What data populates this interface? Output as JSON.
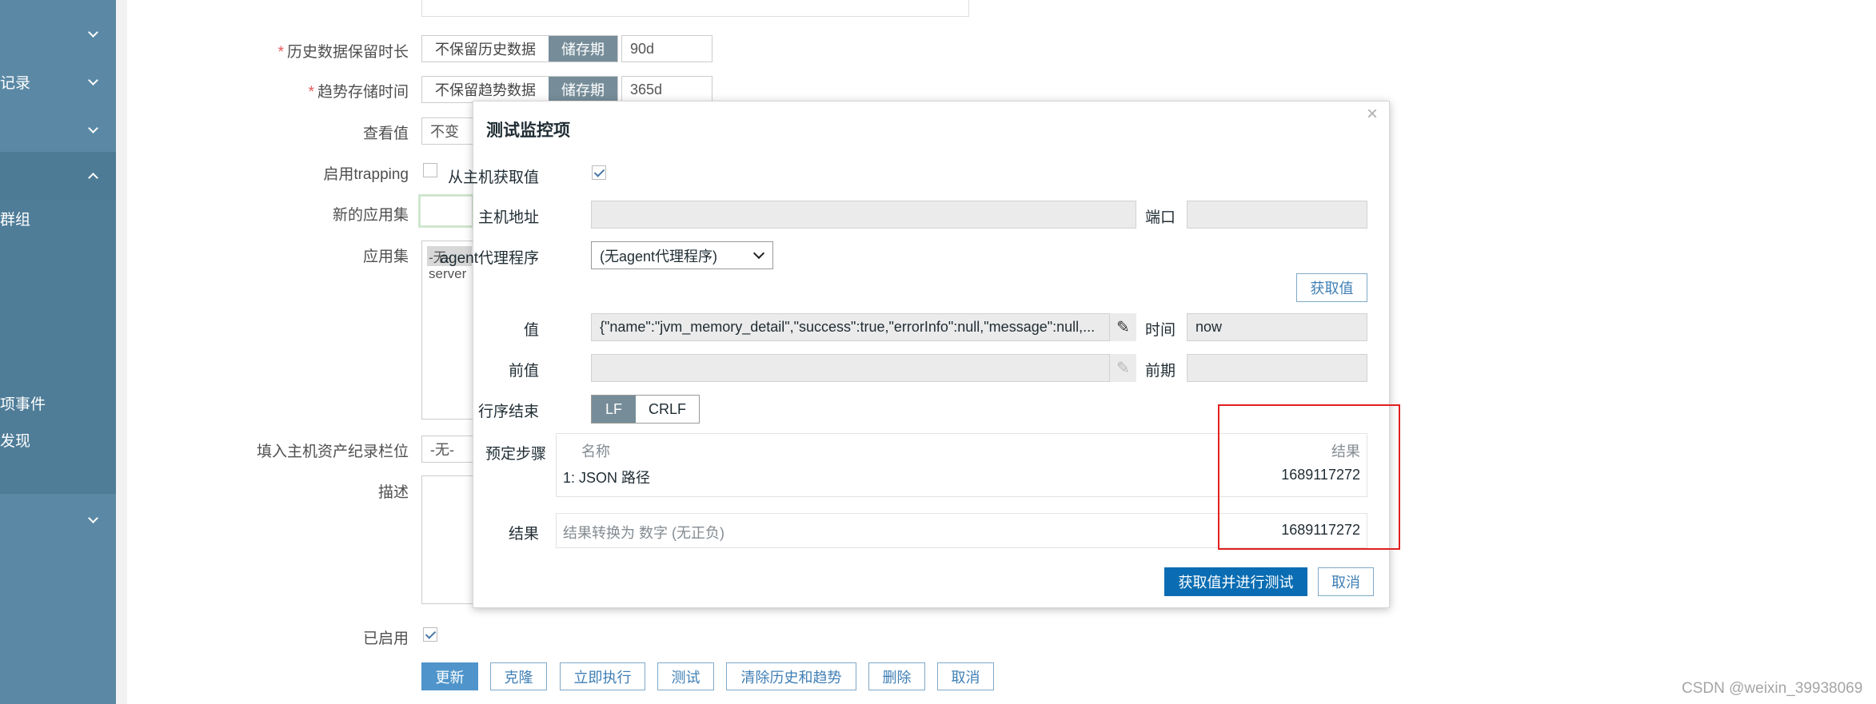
{
  "sidebar": {
    "items": [
      {
        "label": ""
      },
      {
        "label": "记录"
      },
      {
        "label": ""
      },
      {
        "label": ""
      },
      {
        "label": "群组"
      },
      {
        "label": "项事件"
      },
      {
        "label": "发现"
      },
      {
        "label": ""
      }
    ]
  },
  "form": {
    "history": {
      "label": "历史数据保留时长",
      "option_off": "不保留历史数据",
      "option_on": "储存期",
      "value": "90d"
    },
    "trends": {
      "label": "趋势存储时间",
      "option_off": "不保留趋势数据",
      "option_on": "储存期",
      "value": "365d"
    },
    "show_value": {
      "label": "查看值",
      "value": "不变"
    },
    "trapping": {
      "label": "启用trapping"
    },
    "new_application": {
      "label": "新的应用集"
    },
    "applications": {
      "label": "应用集",
      "options": [
        "-无-",
        "server"
      ]
    },
    "inventory": {
      "label": "填入主机资产纪录栏位",
      "value": "-无-"
    },
    "description": {
      "label": "描述"
    },
    "enabled": {
      "label": "已启用"
    },
    "buttons": {
      "update": "更新",
      "clone": "克隆",
      "execute_now": "立即执行",
      "test": "测试",
      "clear": "清除历史和趋势",
      "delete": "删除",
      "cancel": "取消"
    }
  },
  "modal": {
    "title": "测试监控项",
    "close": "×",
    "get_from_host": {
      "label": "从主机获取值",
      "checked": true
    },
    "host_address": {
      "label": "主机地址",
      "value": ""
    },
    "port": {
      "label": "端口",
      "value": ""
    },
    "proxy": {
      "label": "agent代理程序",
      "selected": "(无agent代理程序)"
    },
    "get_value_button": "获取值",
    "value": {
      "label": "值",
      "text": "{\"name\":\"jvm_memory_detail\",\"success\":true,\"errorInfo\":null,\"message\":null,..."
    },
    "time": {
      "label": "时间",
      "value": "now"
    },
    "prev_value": {
      "label": "前值",
      "value": ""
    },
    "prev_time": {
      "label": "前期",
      "value": ""
    },
    "eol": {
      "label": "行序结束",
      "options": [
        "LF",
        "CRLF"
      ],
      "selected": "LF"
    },
    "preprocessing": {
      "label": "预定步骤",
      "headers": {
        "name": "名称",
        "result": "结果"
      },
      "steps": [
        {
          "name": "1:  JSON 路径",
          "result": "1689117272"
        }
      ]
    },
    "result": {
      "label": "结果",
      "description": "结果转换为 数字 (无正负)",
      "value": "1689117272"
    },
    "buttons": {
      "test": "获取值并进行测试",
      "cancel": "取消"
    }
  },
  "watermark": "CSDN @weixin_39938069",
  "colors": {
    "sidebar": "#5b89a5",
    "primary": "#0275b8",
    "segment_active": "#768d99",
    "highlight": "#e02020"
  }
}
